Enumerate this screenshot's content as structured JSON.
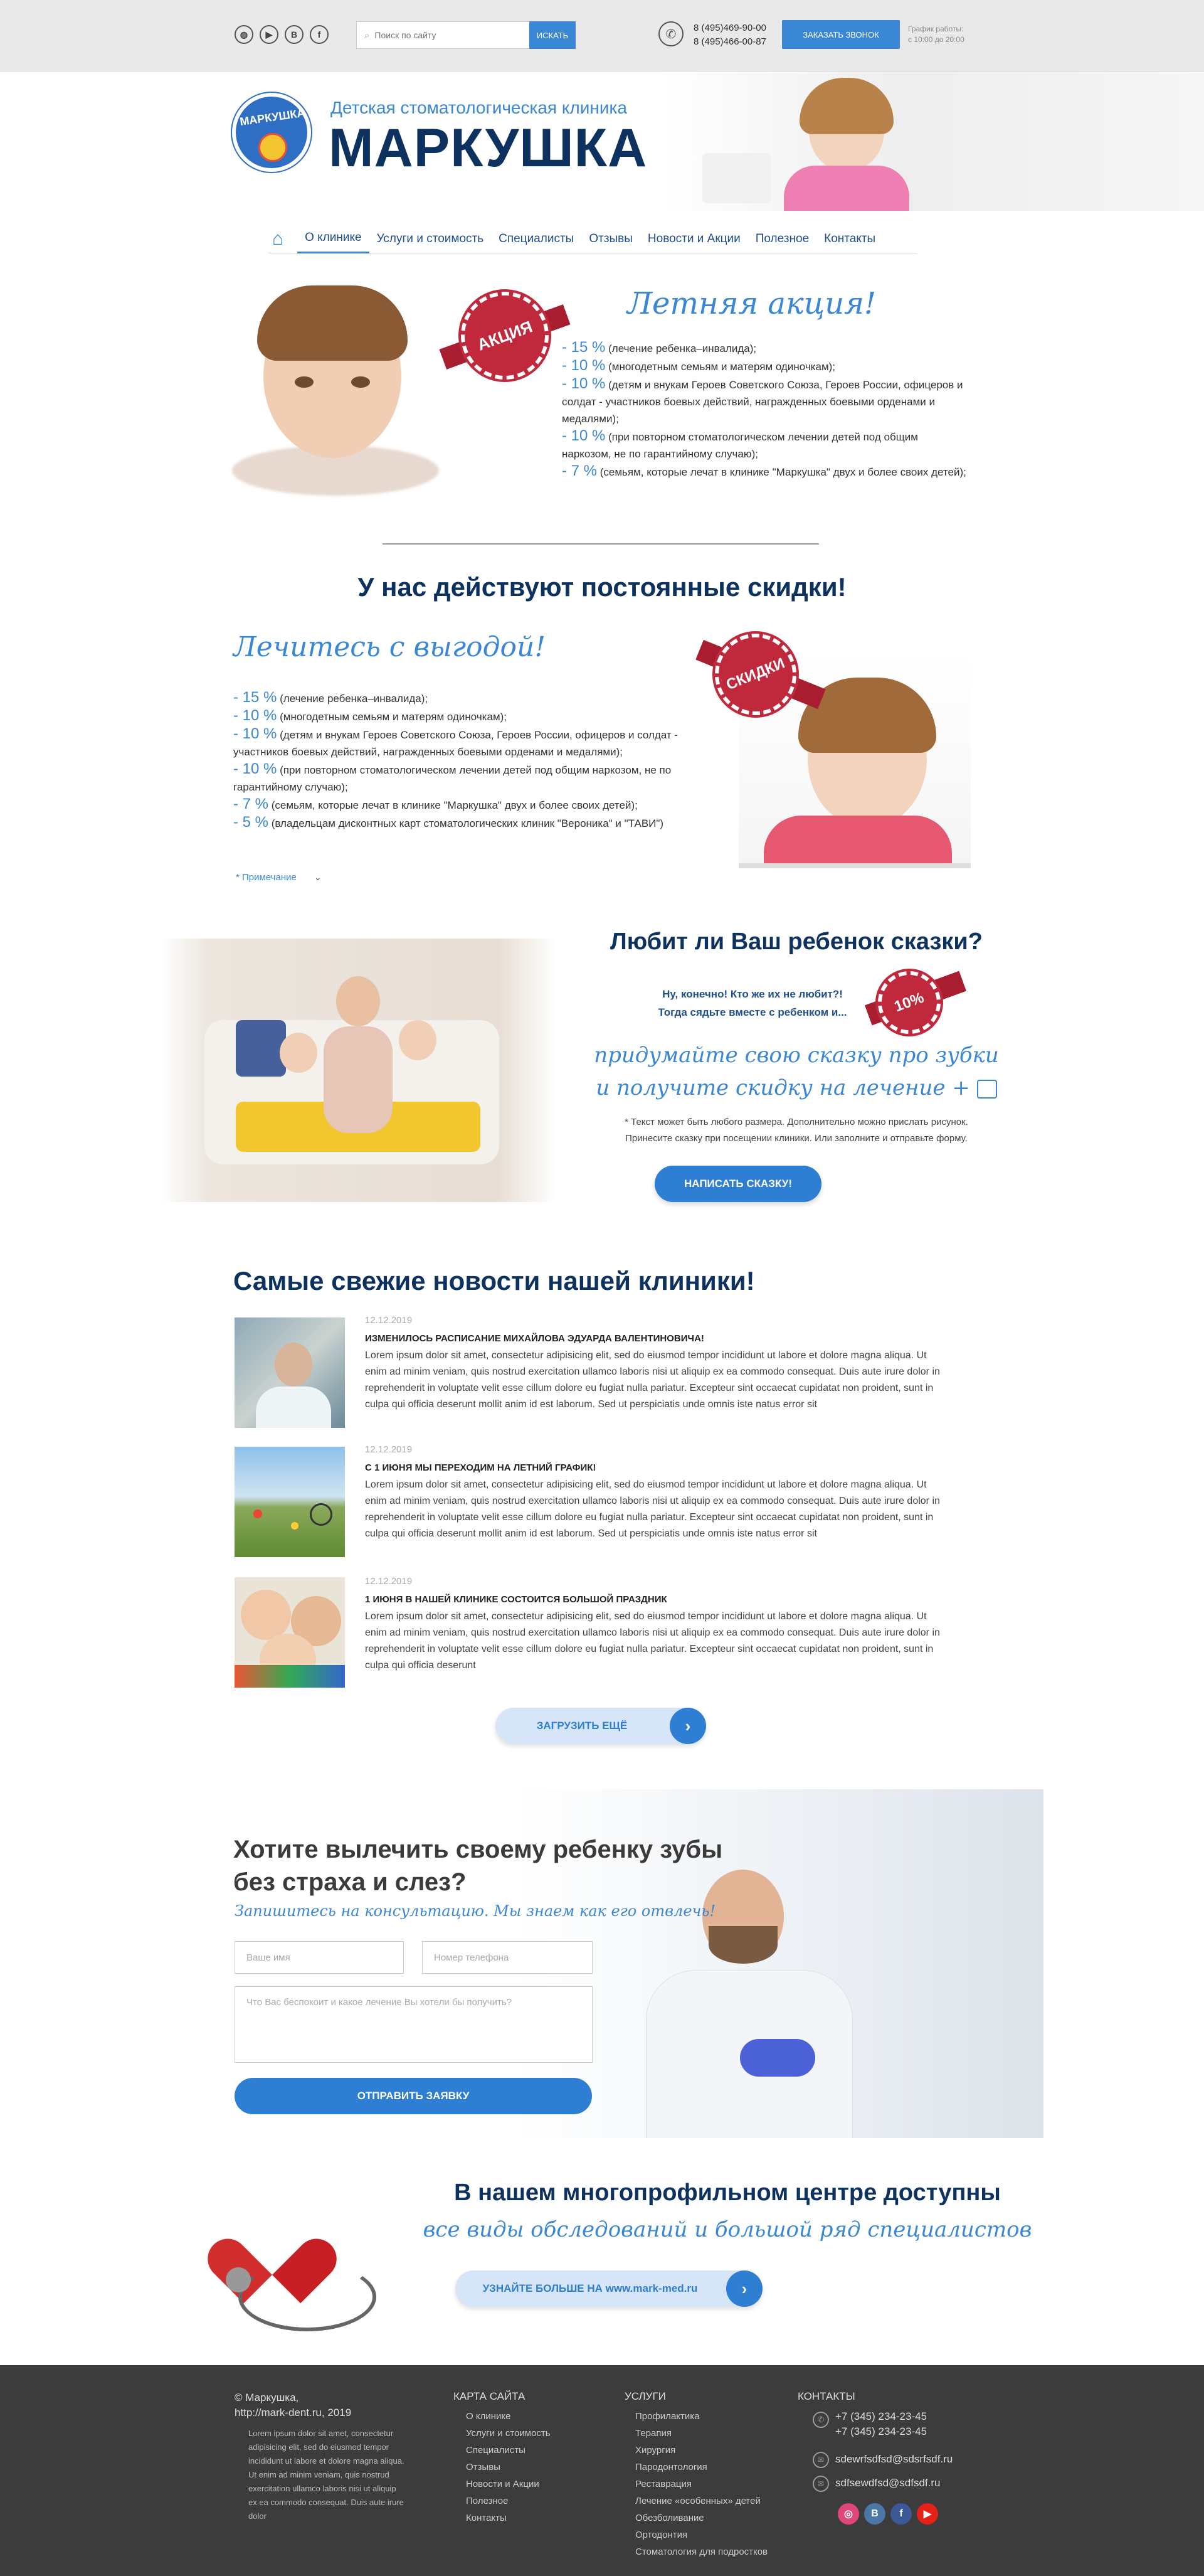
{
  "topbar": {
    "socials": [
      "globe-icon",
      "youtube-icon",
      "vk-icon",
      "facebook-icon"
    ],
    "search_placeholder": "Поиск по сайту",
    "search_button": "ИСКАТЬ",
    "phone1": "8 (495)469-90-00",
    "phone2": "8 (495)466-00-87",
    "call_button": "ЗАКАЗАТЬ ЗВОНОК",
    "hours1": "График работы:",
    "hours2": "с 10:00 до 20:00"
  },
  "header": {
    "logo_letters": "МАРКУШКА",
    "subtitle": "Детская стоматологическая клиника",
    "title": "МАРКУШКА"
  },
  "nav": {
    "items": [
      "О клинике",
      "Услуги и стоимость",
      "Специалисты",
      "Отзывы",
      "Новости и Акции",
      "Полезное",
      "Контакты"
    ]
  },
  "summer": {
    "badge": "АКЦИЯ",
    "title": "Летняя акция!",
    "items": [
      {
        "pct": "- 15 %",
        "text": "(лечение ребенка–инвалида);"
      },
      {
        "pct": "- 10 %",
        "text": "(многодетным семьям и матерям одиночкам);"
      },
      {
        "pct": "- 10 %",
        "text": "(детям и внукам Героев Советского Союза, Героев России, офицеров и солдат - участников боевых действий, награжденных боевыми орденами и медалями);"
      },
      {
        "pct": "- 10 %",
        "text": "(при повторном стоматологическом лечении детей под общим наркозом, не по гарантийному случаю);"
      },
      {
        "pct": "- 7 %",
        "text": "(семьям, которые лечат в клинике \"Маркушка\" двух и более своих детей);"
      }
    ]
  },
  "discounts": {
    "title": "У нас действуют постоянные скидки!",
    "subtitle": "Лечитесь с выгодой!",
    "badge": "СКИДКИ",
    "items": [
      {
        "pct": "- 15 %",
        "text": "(лечение ребенка–инвалида);"
      },
      {
        "pct": "- 10 %",
        "text": "(многодетным семьям и матерям одиночкам);"
      },
      {
        "pct": "- 10 %",
        "text": "(детям и внукам Героев Советского Союза, Героев России, офицеров и солдат - участников боевых действий, награжденных боевыми орденами и медалями);"
      },
      {
        "pct": "- 10 %",
        "text": "(при повторном стоматологическом лечении детей под общим наркозом, не по гарантийному случаю);"
      },
      {
        "pct": "- 7 %",
        "text": "(семьям, которые лечат в клинике \"Маркушка\" двух и более своих детей);"
      },
      {
        "pct": "- 5 %",
        "text": "(владельцам дисконтных карт стоматологических клиник \"Вероника\" и \"ТАВИ\")"
      }
    ],
    "note": "* Примечание"
  },
  "tales": {
    "title": "Любит ли Ваш ребенок сказки?",
    "line1": "Ну, конечно! Кто же их не любит?!",
    "line2": "Тогда сядьте вместе с ребенком и...",
    "badge": "10%",
    "script1": "придумайте свою сказку про зубки",
    "script2": "и получите скидку на лечение +",
    "note1": "* Текст может быть любого размера. Дополнительно можно прислать рисунок.",
    "note2": "Принесите сказку при посещении клиники. Или заполните и отправьте форму.",
    "button": "НАПИСАТЬ СКАЗКУ!"
  },
  "news": {
    "title": "Самые свежие новости нашей клиники!",
    "items": [
      {
        "date": "12.12.2019",
        "title": "Изменилось расписание Михайлова Эдуарда Валентиновича!",
        "text": "Lorem ipsum dolor sit amet, consectetur adipisicing elit, sed do eiusmod tempor incididunt ut labore et dolore magna aliqua. Ut enim ad minim veniam, quis nostrud exercitation ullamco laboris nisi ut aliquip ex ea commodo consequat. Duis aute irure dolor in reprehenderit in voluptate velit esse cillum dolore eu fugiat nulla pariatur. Excepteur sint occaecat cupidatat non proident, sunt in culpa qui officia deserunt mollit anim id est laborum. Sed ut perspiciatis unde omnis iste natus error sit"
      },
      {
        "date": "12.12.2019",
        "title": "С 1 июня мы переходим на летний график!",
        "text": "Lorem ipsum dolor sit amet, consectetur adipisicing elit, sed do eiusmod tempor incididunt ut labore et dolore magna aliqua. Ut enim ad minim veniam, quis nostrud exercitation ullamco laboris nisi ut aliquip ex ea commodo consequat. Duis aute irure dolor in reprehenderit in voluptate velit esse cillum dolore eu fugiat nulla pariatur. Excepteur sint occaecat cupidatat non proident, sunt in culpa qui officia deserunt mollit anim id est laborum. Sed ut perspiciatis unde omnis iste natus error sit"
      },
      {
        "date": "12.12.2019",
        "title": "1 июня в нашей клинике состоится большой праздник",
        "text": "Lorem ipsum dolor sit amet, consectetur adipisicing elit, sed do eiusmod tempor incididunt ut labore et dolore magna aliqua. Ut enim ad minim veniam, quis nostrud exercitation ullamco laboris nisi ut aliquip ex ea commodo consequat. Duis aute irure dolor in reprehenderit in voluptate velit esse cillum dolore eu fugiat nulla pariatur. Excepteur sint occaecat cupidatat non proident, sunt in culpa qui officia deserunt"
      }
    ],
    "load_more": "ЗАГРУЗИТЬ ЕЩЁ"
  },
  "consult": {
    "title1": "Хотите вылечить своему ребенку зубы",
    "title2": "без страха и слез?",
    "script": "Запишитесь на консультацию. Мы знаем как его отвлечь!",
    "name_placeholder": "Ваше имя",
    "phone_placeholder": "Номер телефона",
    "message_placeholder": "Что Вас беспокоит и какое лечение Вы хотели бы получить?",
    "submit": "ОТПРАВИТЬ ЗАЯВКУ"
  },
  "center": {
    "title": "В нашем многопрофильном центре доступны",
    "script": "все виды обследований и большой ряд специалистов",
    "button": "УЗНАЙТЕ БОЛЬШЕ НА www.mark-med.ru"
  },
  "footer": {
    "copyright1": "© Маркушка,",
    "copyright2": "http://mark-dent.ru, 2019",
    "about": "Lorem ipsum dolor sit amet, consectetur adipisicing elit, sed do eiusmod tempor incididunt ut labore et dolore magna aliqua. Ut enim ad minim veniam, quis nostrud exercitation ullamco laboris nisi ut aliquip ex ea commodo consequat. Duis aute irure dolor",
    "sitemap_title": "КАРТА САЙТА",
    "sitemap": [
      "О клинике",
      "Услуги и стоимость",
      "Специалисты",
      "Отзывы",
      "Новости и Акции",
      "Полезное",
      "Контакты"
    ],
    "services_title": "УСЛУГИ",
    "services": [
      "Профилактика",
      "Терапия",
      "Хирургия",
      "Пародонтология",
      "Реставрация",
      "Лечение «особенных» детей",
      "Обезболивание",
      "Ортодонтия",
      "Стоматология для подростков"
    ],
    "contacts_title": "КОНТАКТЫ",
    "phone1": "+7 (345) 234-23-45",
    "phone2": "+7 (345) 234-23-45",
    "email1": "sdewrfsdfsd@sdsrfsdf.ru",
    "email2": "sdfsewdfsd@sdfsdf.ru",
    "social_letters": [
      "◎",
      "B",
      "f",
      "▶"
    ],
    "social_colors": [
      "#e0457b",
      "#4a76a8",
      "#3b5998",
      "#e62117"
    ]
  }
}
